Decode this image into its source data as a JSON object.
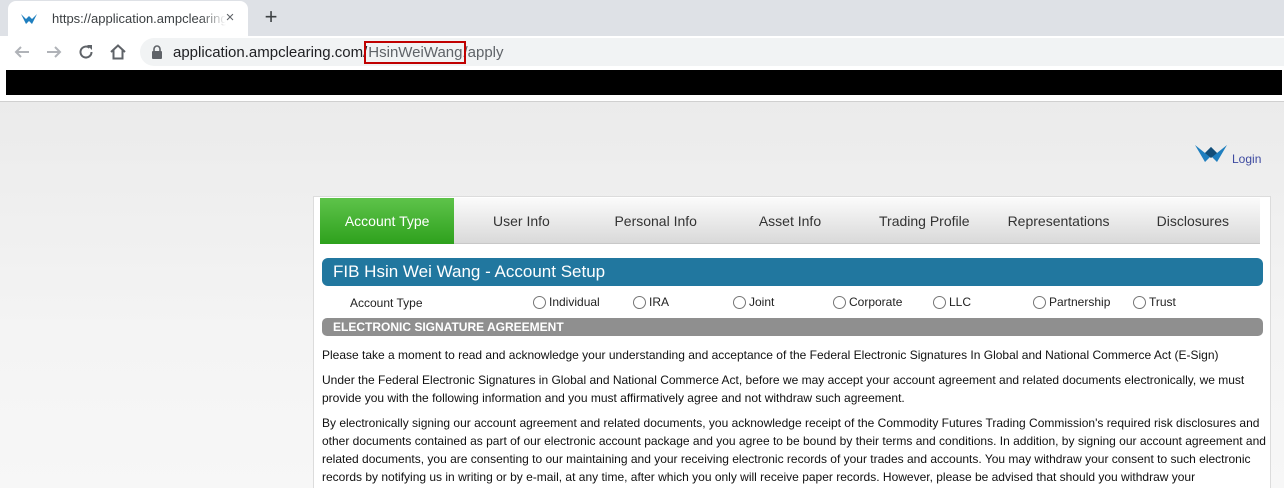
{
  "browser": {
    "tab_title": "https://application.ampclearing.com/HsinWeiWang/apply",
    "tab_close": "×",
    "new_tab": "+",
    "url_prefix": "application.ampclearing.com/",
    "url_highlight": "HsinWeiWang",
    "url_suffix": "/apply",
    "highlight_color": "#c00000"
  },
  "header": {
    "login_label": "Login"
  },
  "steps": {
    "items": [
      {
        "label": "Account Type",
        "active": true
      },
      {
        "label": "User Info"
      },
      {
        "label": "Personal Info"
      },
      {
        "label": "Asset Info"
      },
      {
        "label": "Trading Profile"
      },
      {
        "label": "Representations"
      },
      {
        "label": "Disclosures"
      }
    ],
    "active_color": "#2ea11d"
  },
  "setup": {
    "title": "FIB Hsin Wei Wang - Account Setup",
    "bar_color": "#21779f"
  },
  "account_type": {
    "label": "Account Type",
    "options": [
      "Individual",
      "IRA",
      "Joint",
      "Corporate",
      "LLC",
      "Partnership",
      "Trust"
    ],
    "selected": ""
  },
  "esign": {
    "heading": "ELECTRONIC SIGNATURE AGREEMENT",
    "paragraphs": [
      "Please take a moment to read and acknowledge your understanding and acceptance of the Federal Electronic Signatures In Global and National Commerce Act (E-Sign)",
      "Under the Federal Electronic Signatures in Global and National Commerce Act, before we may accept your account agreement and related documents electronically, we must provide you with the following information and you must affirmatively agree and not withdraw such agreement.",
      "By electronically signing our account agreement and related documents, you acknowledge receipt of the Commodity Futures Trading Commission's required risk disclosures and other documents contained as part of our electronic account package and you agree to be bound by their terms and conditions. In addition, by signing our account agreement and related documents, you are consenting to our maintaining and your receiving electronic records of your trades and accounts. You may withdraw your consent to such electronic records by notifying us in writing or by e-mail, at any time, after which you only will receive paper records. However, please be advised that should you withdraw your"
    ]
  }
}
